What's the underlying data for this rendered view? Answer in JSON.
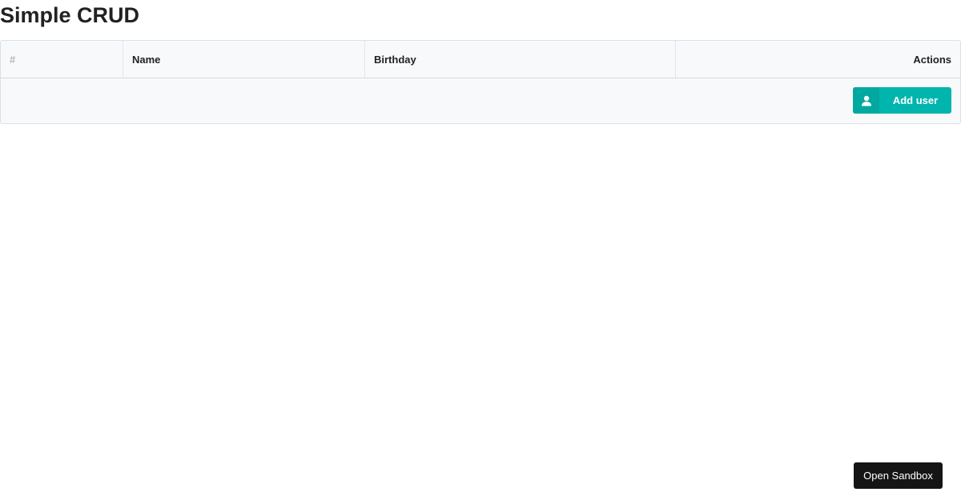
{
  "page": {
    "title": "Simple CRUD"
  },
  "table": {
    "columns": [
      "#",
      "Name",
      "Birthday",
      "Actions"
    ],
    "rows": [],
    "add_button_label": "Add user"
  },
  "sandbox": {
    "button_label": "Open Sandbox"
  },
  "icons": {
    "add_user": "user-icon"
  },
  "colors": {
    "accent": "#00b5ad",
    "sandbox_button": "#151515"
  }
}
